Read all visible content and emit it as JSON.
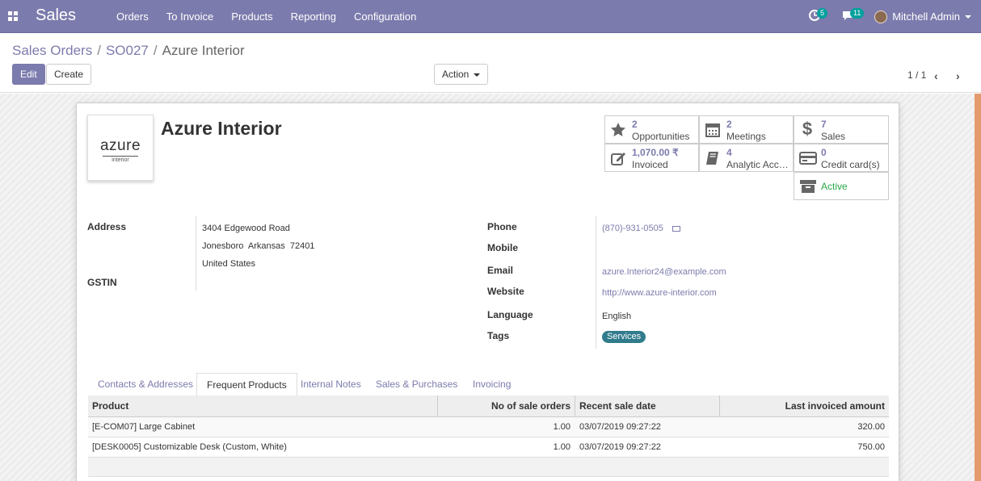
{
  "navbar": {
    "app_name": "Sales",
    "menu": [
      "Orders",
      "To Invoice",
      "Products",
      "Reporting",
      "Configuration"
    ],
    "activity_count": "5",
    "messages_count": "11",
    "user_name": "Mitchell Admin",
    "brand_color": "#7c7bad"
  },
  "breadcrumb": {
    "items": [
      "Sales Orders",
      "SO027"
    ],
    "current": "Azure Interior"
  },
  "buttons": {
    "edit": "Edit",
    "create": "Create",
    "action": "Action"
  },
  "pager": {
    "value": "1 / 1"
  },
  "partner": {
    "name": "Azure Interior",
    "logo_text": "azure",
    "logo_subtext": "interior"
  },
  "smart_buttons": [
    {
      "value": "2",
      "label": "Opportunities",
      "icon": "star-icon"
    },
    {
      "value": "2",
      "label": "Meetings",
      "icon": "calendar-icon"
    },
    {
      "value": "7",
      "label": "Sales",
      "icon": "dollar-icon"
    },
    {
      "value": "1,070.00 ₹",
      "label": "Invoiced",
      "icon": "pencil-square-icon"
    },
    {
      "value": "4",
      "label": "Analytic Acc…",
      "icon": "book-icon"
    },
    {
      "value": "0",
      "label": "Credit card(s)",
      "icon": "credit-card-icon"
    },
    {
      "value": "",
      "label": "Active",
      "icon": "archive-icon"
    }
  ],
  "address": {
    "label": "Address",
    "street": "3404 Edgewood Road",
    "city_line": "Jonesboro  Arkansas  72401",
    "country": "United States",
    "gstin_label": "GSTIN"
  },
  "contact": {
    "phone_label": "Phone",
    "phone": "(870)-931-0505",
    "mobile_label": "Mobile",
    "email_label": "Email",
    "email": "azure.Interior24@example.com",
    "website_label": "Website",
    "website": "http://www.azure-interior.com",
    "language_label": "Language",
    "language": "English",
    "tags_label": "Tags",
    "tag": "Services"
  },
  "tabs": [
    "Contacts & Addresses",
    "Frequent Products",
    "Internal Notes",
    "Sales & Purchases",
    "Invoicing"
  ],
  "table": {
    "headers": [
      "Product",
      "No of sale orders",
      "Recent sale date",
      "Last invoiced amount"
    ],
    "rows": [
      {
        "product": "[E-COM07] Large Cabinet",
        "orders": "1.00",
        "date": "03/07/2019 09:27:22",
        "amount": "320.00"
      },
      {
        "product": "[DESK0005] Customizable Desk (Custom, White)",
        "orders": "1.00",
        "date": "03/07/2019 09:27:22",
        "amount": "750.00"
      }
    ]
  }
}
